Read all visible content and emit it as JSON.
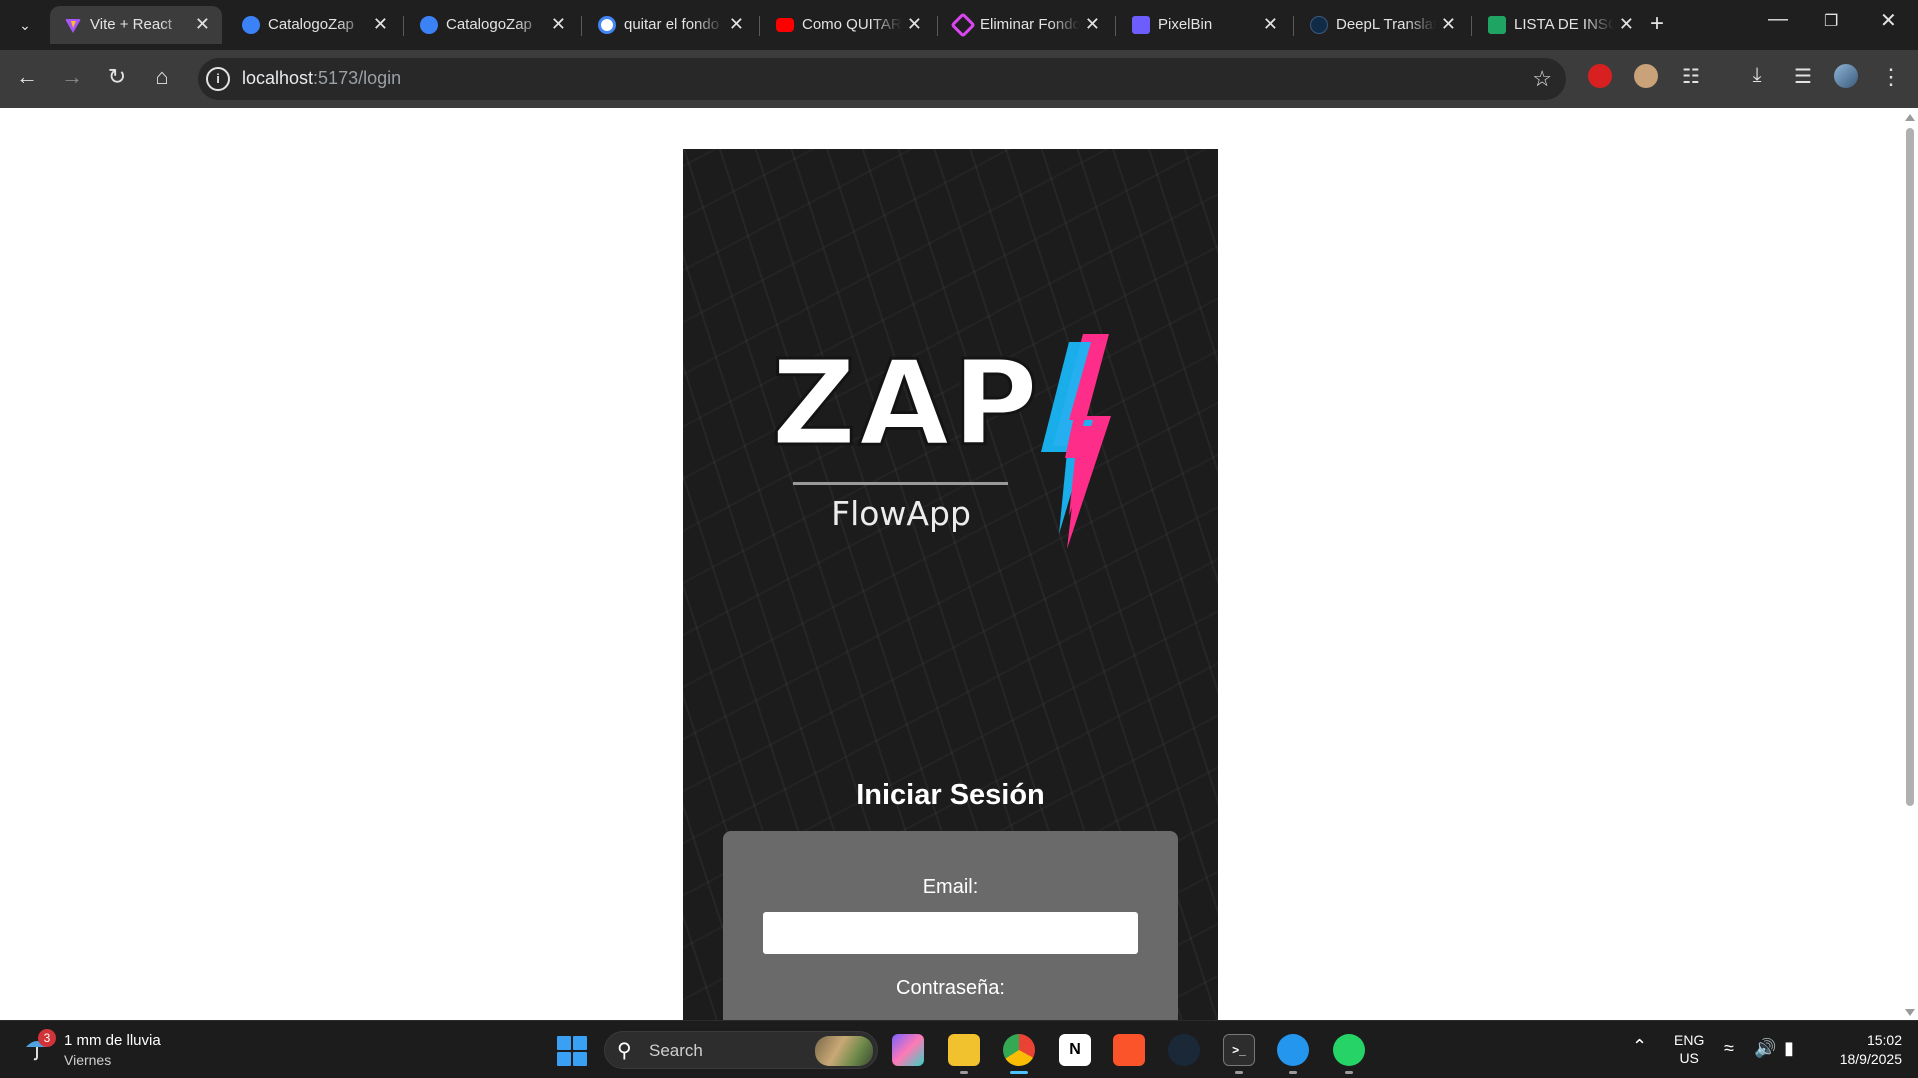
{
  "browser": {
    "tabs": [
      {
        "title": "Vite + React",
        "favicon": "vite-icon",
        "color": "#a855f7",
        "active": true
      },
      {
        "title": "CatalogoZap",
        "favicon": "catalogo-icon",
        "color": "#3b82f6",
        "active": false
      },
      {
        "title": "CatalogoZap",
        "favicon": "catalogo-icon",
        "color": "#3b82f6",
        "active": false
      },
      {
        "title": "quitar el fondo",
        "favicon": "google-icon",
        "color": "#ffffff",
        "active": false
      },
      {
        "title": "Como QUITAR",
        "favicon": "youtube-icon",
        "color": "#ff0000",
        "active": false
      },
      {
        "title": "Eliminar Fondo",
        "favicon": "eliminar-icon",
        "color": "#d946ef",
        "active": false
      },
      {
        "title": "PixelBin",
        "favicon": "pixelbin-icon",
        "color": "#6d5dfc",
        "active": false
      },
      {
        "title": "DeepL Translate",
        "favicon": "deepl-icon",
        "color": "#0f2b46",
        "active": false
      },
      {
        "title": "LISTA DE INSCRITOS",
        "favicon": "sheets-icon",
        "color": "#1fa463",
        "active": false
      }
    ],
    "url_host": "localhost",
    "url_path": ":5173/login"
  },
  "page": {
    "logo_text": "ZAP",
    "logo_subtitle": "FlowApp",
    "title": "Iniciar Sesión",
    "email_label": "Email:",
    "email_value": "",
    "password_label": "Contraseña:"
  },
  "taskbar": {
    "weather_text": "1 mm de lluvia",
    "weather_day": "Viernes",
    "weather_badge": "3",
    "search_placeholder": "Search",
    "lang_line1": "ENG",
    "lang_line2": "US",
    "time": "15:02",
    "date": "18/9/2025",
    "apps": [
      {
        "name": "copilot-icon",
        "color": "#7b61ff"
      },
      {
        "name": "file-explorer-icon",
        "color": "#f2c12e"
      },
      {
        "name": "chrome-icon",
        "color": "#34a853",
        "active": true
      },
      {
        "name": "notion-icon",
        "color": "#ffffff"
      },
      {
        "name": "brave-icon",
        "color": "#fb542b"
      },
      {
        "name": "steam-icon",
        "color": "#1b2838"
      },
      {
        "name": "terminal-icon",
        "color": "#2d2d2d"
      },
      {
        "name": "docker-icon",
        "color": "#2496ed"
      },
      {
        "name": "whatsapp-icon",
        "color": "#25d366"
      }
    ]
  },
  "colors": {
    "card_bg": "#1c1c1c",
    "form_bg": "#6a6a6a",
    "bolt_pink": "#ff2d8a",
    "bolt_blue": "#19b5f5"
  }
}
